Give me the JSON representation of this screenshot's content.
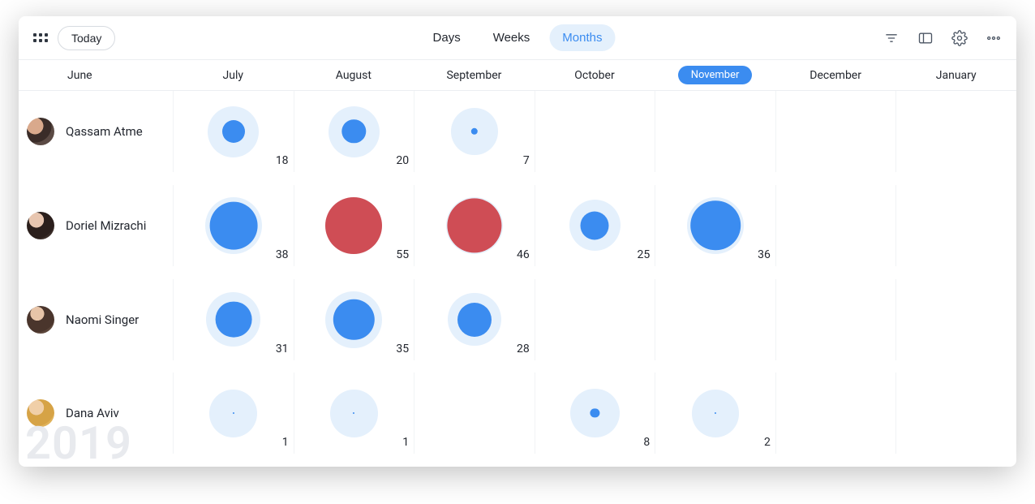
{
  "toolbar": {
    "today_label": "Today",
    "ranges": {
      "days": "Days",
      "weeks": "Weeks",
      "months": "Months"
    },
    "active_range": "months"
  },
  "months": [
    {
      "key": "june",
      "label": "June"
    },
    {
      "key": "july",
      "label": "July"
    },
    {
      "key": "august",
      "label": "August"
    },
    {
      "key": "september",
      "label": "September"
    },
    {
      "key": "october",
      "label": "October"
    },
    {
      "key": "november",
      "label": "November",
      "current": true
    },
    {
      "key": "december",
      "label": "December"
    },
    {
      "key": "january",
      "label": "January"
    }
  ],
  "year_watermark": "2019",
  "colors": {
    "blue": "#3b8cf0",
    "red": "#cf4d55",
    "light": "#e4f0fc"
  },
  "people": [
    {
      "name": "Qassam Atme",
      "avatar": "a1",
      "cells": {
        "july": {
          "value": 18,
          "color": "blue",
          "outer_pct": 90,
          "inner_pct": 40
        },
        "august": {
          "value": 20,
          "color": "blue",
          "outer_pct": 90,
          "inner_pct": 42
        },
        "september": {
          "value": 7,
          "color": "blue",
          "outer_pct": 82,
          "inner_pct": 12
        }
      }
    },
    {
      "name": "Doriel Mizrachi",
      "avatar": "a2",
      "cells": {
        "july": {
          "value": 38,
          "color": "blue",
          "outer_pct": 100,
          "inner_pct": 84
        },
        "august": {
          "value": 55,
          "color": "red",
          "outer_pct": 100,
          "inner_pct": 100
        },
        "september": {
          "value": 46,
          "color": "red",
          "outer_pct": 100,
          "inner_pct": 96
        },
        "october": {
          "value": 25,
          "color": "blue",
          "outer_pct": 90,
          "inner_pct": 50
        },
        "november": {
          "value": 36,
          "color": "blue",
          "outer_pct": 100,
          "inner_pct": 88
        }
      }
    },
    {
      "name": "Naomi Singer",
      "avatar": "a3",
      "cells": {
        "july": {
          "value": 31,
          "color": "blue",
          "outer_pct": 96,
          "inner_pct": 64
        },
        "august": {
          "value": 35,
          "color": "blue",
          "outer_pct": 100,
          "inner_pct": 72
        },
        "september": {
          "value": 28,
          "color": "blue",
          "outer_pct": 94,
          "inner_pct": 60
        }
      }
    },
    {
      "name": "Dana Aviv",
      "avatar": "a4",
      "cells": {
        "july": {
          "value": 1,
          "color": "blue",
          "outer_pct": 84,
          "inner_pct": 3
        },
        "august": {
          "value": 1,
          "color": "blue",
          "outer_pct": 84,
          "inner_pct": 3
        },
        "october": {
          "value": 8,
          "color": "blue",
          "outer_pct": 86,
          "inner_pct": 16
        },
        "november": {
          "value": 2,
          "color": "blue",
          "outer_pct": 84,
          "inner_pct": 3
        }
      }
    }
  ],
  "chart_data": {
    "type": "heatmap",
    "title": "",
    "xlabel": "",
    "ylabel": "",
    "x": [
      "July",
      "August",
      "September",
      "October",
      "November"
    ],
    "y": [
      "Qassam Atme",
      "Doriel Mizrachi",
      "Naomi Singer",
      "Dana Aviv"
    ],
    "series": [
      {
        "name": "Qassam Atme",
        "values": [
          18,
          20,
          7,
          null,
          null
        ]
      },
      {
        "name": "Doriel Mizrachi",
        "values": [
          38,
          55,
          46,
          25,
          36
        ]
      },
      {
        "name": "Naomi Singer",
        "values": [
          31,
          35,
          28,
          null,
          null
        ]
      },
      {
        "name": "Dana Aviv",
        "values": [
          1,
          1,
          null,
          8,
          2
        ]
      }
    ],
    "threshold_red": 40
  }
}
